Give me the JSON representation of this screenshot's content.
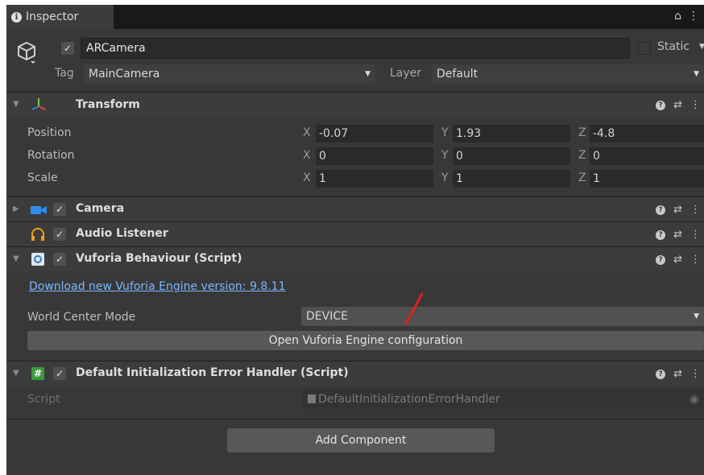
{
  "tab": {
    "title": "Inspector"
  },
  "gameobject": {
    "name": "ARCamera",
    "static_label": "Static",
    "tag_label": "Tag",
    "tag_value": "MainCamera",
    "layer_label": "Layer",
    "layer_value": "Default"
  },
  "transform": {
    "title": "Transform",
    "rows": [
      {
        "label": "Position",
        "x": "-0.07",
        "y": "1.93",
        "z": "-4.8"
      },
      {
        "label": "Rotation",
        "x": "0",
        "y": "0",
        "z": "0"
      },
      {
        "label": "Scale",
        "x": "1",
        "y": "1",
        "z": "1"
      }
    ],
    "axes": {
      "x": "X",
      "y": "Y",
      "z": "Z"
    }
  },
  "camera": {
    "title": "Camera"
  },
  "audio_listener": {
    "title": "Audio Listener"
  },
  "vuforia": {
    "title": "Vuforia Behaviour (Script)",
    "download_link": "Download new Vuforia Engine version: 9.8.11",
    "world_center_label": "World Center Mode",
    "world_center_value": "DEVICE",
    "open_config_button": "Open Vuforia Engine configuration"
  },
  "error_handler": {
    "title": "Default Initialization Error Handler (Script)",
    "script_label": "Script",
    "script_value": "DefaultInitializationErrorHandler"
  },
  "add_component_button": "Add Component",
  "colors": {
    "panel": "#383838",
    "header": "#3c3c3c",
    "field": "#2a2a2a",
    "link": "#7ab8ff",
    "annotation": "#e02020"
  }
}
